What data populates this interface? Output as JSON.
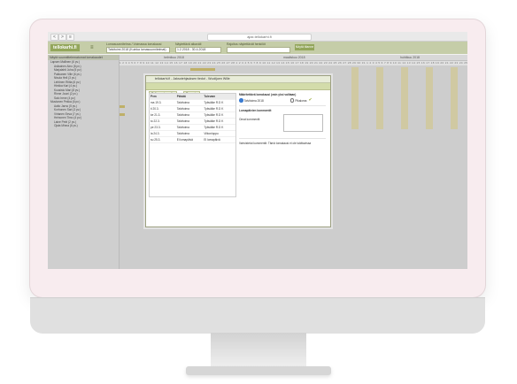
{
  "browser": {
    "url": "ajax.tellokarhi.fi",
    "nav": {
      "back": "<",
      "forward": ">",
      "menu": "≡"
    }
  },
  "app": {
    "logo": "tellokarhi.fi",
    "menu_icon": "hamburger-icon",
    "filters": [
      {
        "label": "Lomasuunnitelma / Voimassa lomakausi",
        "value": "Talvitoimi 2018 (Kuinka lomasuunnitelmat)"
      },
      {
        "label": "Näytettävä aikaväli",
        "value": "1.2.2018 - 30.4.2018"
      },
      {
        "label": "Rajoitus näytettävät henkilöt",
        "value": ""
      }
    ],
    "search_button": "Näytä tilanne"
  },
  "sidebar": {
    "header": "Näytä suunnittelematomat lomakaudet",
    "people": [
      "Lapsen Mallinen (6 pv.)",
      "Asikainen Aino (8 pv.)",
      "Marjalahti Juha (5 pv.)",
      "Pakkanen Ville (6 pv.)",
      "Nisula Heli (3 pv.)",
      "Lehtinen Riitta (6 pv.)",
      "Hiekka Kari (4 pv.)",
      "Kuusisto Mari (8 pv.)",
      "Rinne Jouni (2 pv.)",
      "Salo Irene (4 pv.)",
      "Mustonen Pekka (6 pv.)",
      "Aalto Jarno (5 pv.)",
      "Korhonen Sari (3 pv.)",
      "Virtanen Eeva (7 pv.)",
      "Heinonen Timo (4 pv.)",
      "Laine Petri (2 pv.)",
      "Ojala Minna (6 pv.)"
    ]
  },
  "calendar": {
    "months": [
      "helmikuu 2018",
      "maaliskuu 2018",
      "huhtikuu 2018"
    ],
    "days": "1 2 3 4 5 6 7 8 9 10 11 12 13 14 15 16 17 18 19 20 21 22 23 24 25 26 27 28 1 2 3 4 5 6 7 8 9 10 11 12 13 14 15 16 17 18 19 20 21 22 23 24 25 26 27 28 29 30 31 1 2 3 4 5 6 7 8 9 10 11 12 13 14 15 16 17 18 19 20 21 22 23 24 25 26 27 28 29 30"
  },
  "modal": {
    "title": "tellokarhi.fi - Jaksotehjauksen tiedot - Wuolijoen Wille",
    "tabs": [
      "Tallenna ja sulje",
      "Peruuta"
    ],
    "table": {
      "headers": [
        "Pvm",
        "Päivää",
        "Tulevam"
      ],
      "rows": [
        [
          "ma 19.3.",
          "Talvitoima",
          "Tyävälke R.D K"
        ],
        [
          "ti 20.3.",
          "Talvitoima",
          "Tyävälke R.D K"
        ],
        [
          "ke 21.3.",
          "Talvitoima",
          "Tyävälke R.D K"
        ],
        [
          "to 22.3.",
          "Talvitoima",
          "Tyävälke R.D K"
        ],
        [
          "pe 23.3.",
          "Talvitoima",
          "Tyävälke R.D K"
        ],
        [
          "la 24.3.",
          "Talvitoima",
          "Viikonloppu"
        ],
        [
          "su 25.3.",
          "Ei lomapäivä",
          "Ei lomapäivä"
        ]
      ]
    },
    "right": {
      "selection_header": "Määritettävä lomakausi (vain yksi valitaan)",
      "options": [
        "Talvitoima 2018",
        "Pikaloma"
      ],
      "comments_header": "Lomapäivien kommentit",
      "comment_label": "Omat kommentit",
      "footer_note": "Vahvistetut kommentit: Tämä lomakausi ei ole lukittavissa"
    }
  }
}
